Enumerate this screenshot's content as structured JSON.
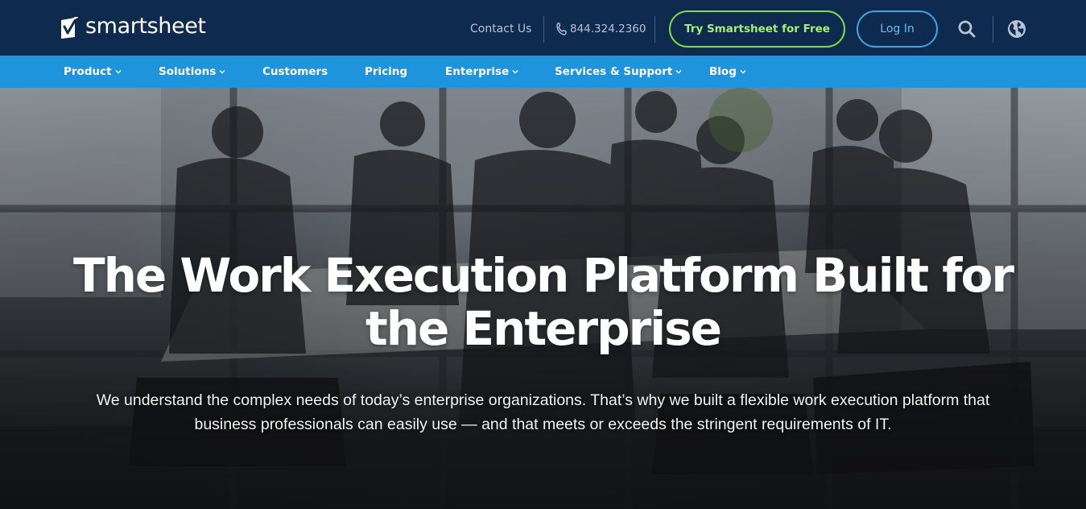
{
  "header": {
    "logo_text": "smartsheet",
    "contact_label": "Contact Us",
    "phone": "844.324.2360",
    "try_button": "Try Smartsheet for Free",
    "login_button": "Log In",
    "icons": [
      "phone-icon",
      "search-icon",
      "globe-icon"
    ]
  },
  "nav": {
    "items": [
      {
        "label": "Product",
        "has_dropdown": true
      },
      {
        "label": "Solutions",
        "has_dropdown": true
      },
      {
        "label": "Customers",
        "has_dropdown": false
      },
      {
        "label": "Pricing",
        "has_dropdown": false
      },
      {
        "label": "Enterprise",
        "has_dropdown": true
      },
      {
        "label": "Services & Support",
        "has_dropdown": true
      },
      {
        "label": "Blog",
        "has_dropdown": true
      }
    ]
  },
  "hero": {
    "title_line1": "The Work Execution Platform Built for",
    "title_line2": "the Enterprise",
    "subtitle_line1": "We understand the complex needs of today’s enterprise organizations. That’s why we built a flexible work execution platform that",
    "subtitle_line2": "business professionals can easily use — and that meets or exceeds the stringent requirements of IT."
  },
  "colors": {
    "header_bg": "#0f2a4f",
    "nav_bg": "#1d94dc",
    "try_button_border": "#7edb4a",
    "login_button_border": "#3fa4e0"
  }
}
